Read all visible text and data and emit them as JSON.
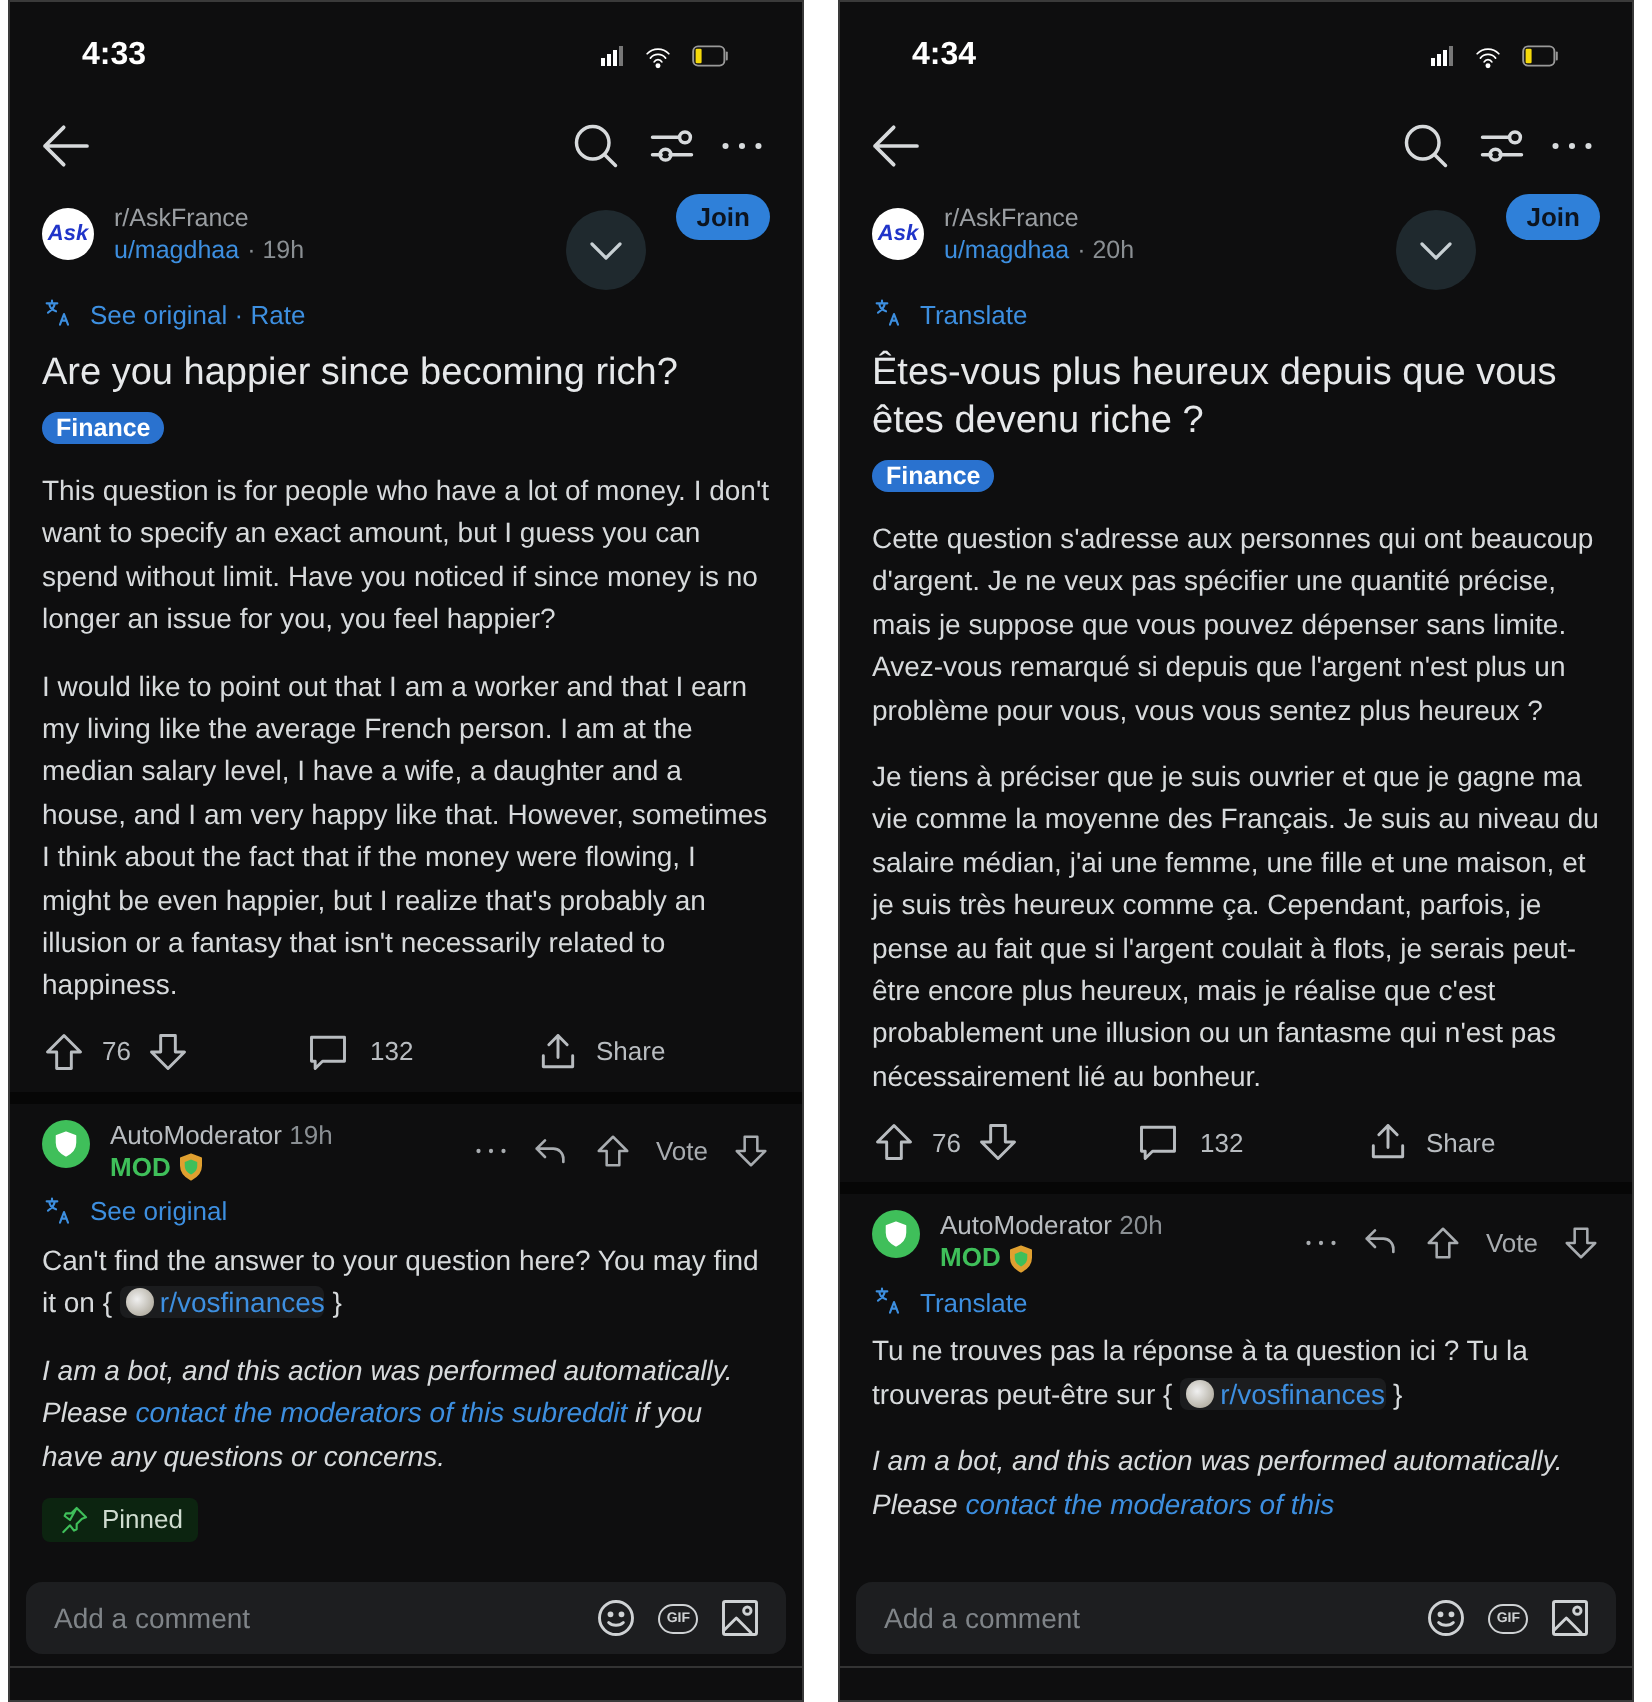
{
  "phones": [
    {
      "time": "4:33",
      "post": {
        "logo_text": "Ask",
        "subreddit": "r/AskFrance",
        "user": "u/magdhaa",
        "age": "· 19h",
        "join": "Join",
        "translate": "See original · Rate",
        "title": "Are you happier since becoming rich?",
        "flair": "Finance",
        "paragraphs": [
          "This question is for people who have a lot of money. I don't want to specify an exact amount, but I guess you can spend without limit. Have you noticed if since money is no longer an issue for you, you feel happier?",
          "I would like to point out that I am a worker and that I earn my living like the average French person. I am at the median salary level, I have a wife, a daughter and a house, and I am very happy like that. However, sometimes I think about the fact that if the money were flowing, I might be even happier, but I realize that's probably an illusion or a fantasy that isn't necessarily related to happiness."
        ],
        "votes": "76",
        "comments": "132",
        "share": "Share"
      },
      "comment": {
        "author": "AutoModerator",
        "age": "19h",
        "mod": "MOD",
        "vote": "Vote",
        "translate": "See original",
        "text": "Can't find the answer to your question here? You may find it on {",
        "link": "r/vosfinances",
        "after": "}",
        "bot": "I am a bot, and this action was performed automatically. Please",
        "bot_link": "contact the moderators of this subreddit",
        "bot_after": "if you have any questions or concerns.",
        "pinned": "Pinned"
      },
      "field": {
        "placeholder": "Add a comment",
        "gif": "GIF"
      }
    },
    {
      "time": "4:34",
      "post": {
        "logo_text": "Ask",
        "subreddit": "r/AskFrance",
        "user": "u/magdhaa",
        "age": "· 20h",
        "join": "Join",
        "translate": "Translate",
        "title": "Êtes-vous plus heureux depuis que vous êtes devenu riche ?",
        "flair": "Finance",
        "paragraphs": [
          "Cette question s'adresse aux personnes qui ont beaucoup d'argent. Je ne veux pas spécifier une quantité précise, mais je suppose que vous pouvez dépenser sans limite. Avez-vous remarqué si depuis que l'argent n'est plus un problème pour vous, vous vous sentez plus heureux ?",
          "Je tiens à préciser que je suis ouvrier et que je gagne ma vie comme la moyenne des Français. Je suis au niveau du salaire médian, j'ai une femme, une fille et une maison, et je suis très heureux comme ça. Cependant, parfois, je pense au fait que si l'argent coulait à flots, je serais peut-être encore plus heureux, mais je réalise que c'est probablement une illusion ou un fantasme qui n'est pas nécessairement lié au bonheur."
        ],
        "votes": "76",
        "comments": "132",
        "share": "Share"
      },
      "comment": {
        "author": "AutoModerator",
        "age": "20h",
        "mod": "MOD",
        "vote": "Vote",
        "translate": "Translate",
        "text": "Tu ne trouves pas la réponse à ta question ici ? Tu la trouveras peut-être sur {",
        "link": "r/vosfinances",
        "after": "}",
        "bot": "I am a bot, and this action was performed automatically. Please",
        "bot_link": "contact the moderators of this"
      },
      "field": {
        "placeholder": "Add a comment",
        "gif": "GIF"
      }
    }
  ]
}
